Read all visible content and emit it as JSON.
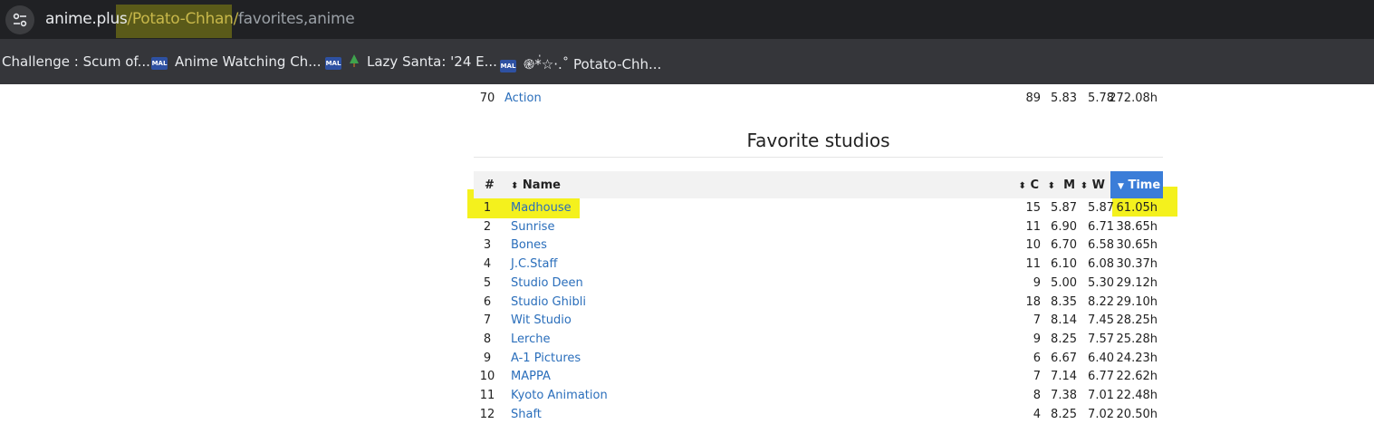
{
  "browser": {
    "url_host": "anime.plus",
    "url_path_highlight": "/Potato-Chhan/",
    "url_path_rest": "favorites,anime",
    "bookmarks": [
      {
        "label": "Challenge : Scum of...",
        "icon": "none"
      },
      {
        "label": "Anime Watching Ch...",
        "icon": "mal-icon"
      },
      {
        "label": "Lazy Santa: '24 E...",
        "icon": "tree-icon"
      },
      {
        "label": "֎*่☆·.˚ Potato-Chh...",
        "icon": "mal-icon"
      }
    ]
  },
  "prev_row": {
    "num": "70",
    "name": "Action",
    "c": "89",
    "m": "5.83",
    "w": "5.78",
    "time": "272.08h"
  },
  "studios": {
    "title": "Favorite studios",
    "headers": {
      "num": "#",
      "name": "Name",
      "c": "C",
      "m": "M",
      "w": "W",
      "time": "Time"
    },
    "rows": [
      {
        "num": "1",
        "name": "Madhouse",
        "c": "15",
        "m": "5.87",
        "w": "5.87",
        "time": "61.05h"
      },
      {
        "num": "2",
        "name": "Sunrise",
        "c": "11",
        "m": "6.90",
        "w": "6.71",
        "time": "38.65h"
      },
      {
        "num": "3",
        "name": "Bones",
        "c": "10",
        "m": "6.70",
        "w": "6.58",
        "time": "30.65h"
      },
      {
        "num": "4",
        "name": "J.C.Staff",
        "c": "11",
        "m": "6.10",
        "w": "6.08",
        "time": "30.37h"
      },
      {
        "num": "5",
        "name": "Studio Deen",
        "c": "9",
        "m": "5.00",
        "w": "5.30",
        "time": "29.12h"
      },
      {
        "num": "6",
        "name": "Studio Ghibli",
        "c": "18",
        "m": "8.35",
        "w": "8.22",
        "time": "29.10h"
      },
      {
        "num": "7",
        "name": "Wit Studio",
        "c": "7",
        "m": "8.14",
        "w": "7.45",
        "time": "28.25h"
      },
      {
        "num": "8",
        "name": "Lerche",
        "c": "9",
        "m": "8.25",
        "w": "7.57",
        "time": "25.28h"
      },
      {
        "num": "9",
        "name": "A-1 Pictures",
        "c": "6",
        "m": "6.67",
        "w": "6.40",
        "time": "24.23h"
      },
      {
        "num": "10",
        "name": "MAPPA",
        "c": "7",
        "m": "7.14",
        "w": "6.77",
        "time": "22.62h"
      },
      {
        "num": "11",
        "name": "Kyoto Animation",
        "c": "8",
        "m": "7.38",
        "w": "7.01",
        "time": "22.48h"
      },
      {
        "num": "12",
        "name": "Shaft",
        "c": "4",
        "m": "8.25",
        "w": "7.02",
        "time": "20.50h"
      }
    ]
  },
  "colors": {
    "link": "#2a6ebb",
    "sort_active": "#3b7dd8",
    "highlighter": "#f4f11d"
  }
}
